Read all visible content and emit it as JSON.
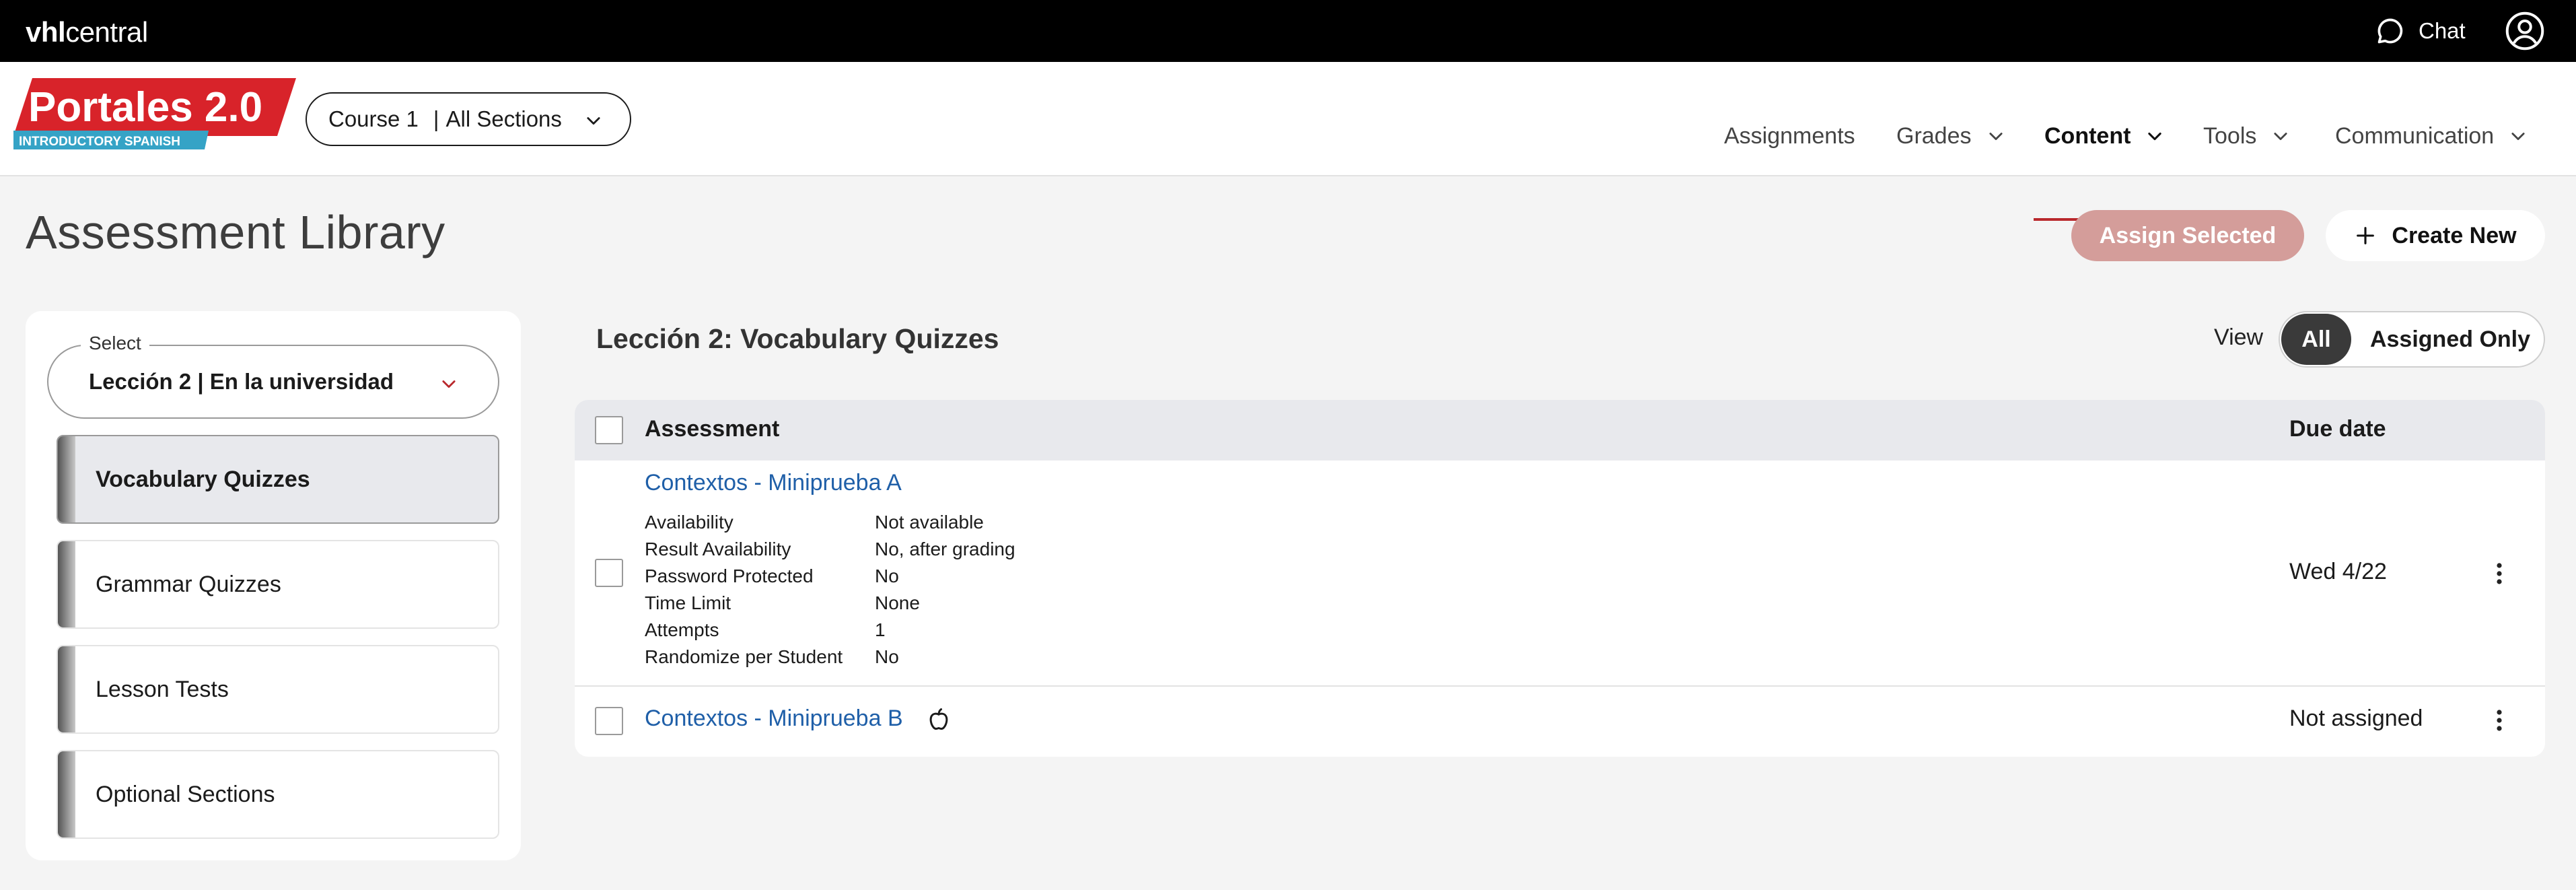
{
  "topbar": {
    "brand_bold": "vhl",
    "brand_light": "central",
    "chat_label": "Chat",
    "icons": [
      "chat-bubble-icon",
      "user-circle-icon"
    ]
  },
  "header": {
    "logo_main": "Portales 2.0",
    "logo_sub": "INTRODUCTORY SPANISH",
    "course": "Course 1",
    "section": "All Sections",
    "nav": [
      {
        "label": "Assignments",
        "active": false,
        "dropdown": false
      },
      {
        "label": "Grades",
        "active": false,
        "dropdown": true
      },
      {
        "label": "Content",
        "active": true,
        "dropdown": true
      },
      {
        "label": "Tools",
        "active": false,
        "dropdown": true
      },
      {
        "label": "Communication",
        "active": false,
        "dropdown": true
      }
    ]
  },
  "page": {
    "title": "Assessment Library",
    "assign_selected_label": "Assign Selected",
    "create_new_label": "Create New"
  },
  "sidebar": {
    "select_legend": "Select",
    "select_value": "Lección 2 | En la universidad",
    "items": [
      {
        "label": "Vocabulary Quizzes",
        "active": true
      },
      {
        "label": "Grammar Quizzes",
        "active": false
      },
      {
        "label": "Lesson Tests",
        "active": false
      },
      {
        "label": "Optional Sections",
        "active": false
      }
    ]
  },
  "main": {
    "section_title": "Lección 2: Vocabulary Quizzes",
    "view_label": "View",
    "view_options": [
      "All",
      "Assigned Only"
    ],
    "view_selected": "All",
    "columns": {
      "assessment": "Assessment",
      "due_date": "Due date"
    },
    "rows": [
      {
        "title": "Contextos - Miniprueba A",
        "due": "Wed 4/22",
        "details": [
          {
            "label": "Availability",
            "value": "Not available"
          },
          {
            "label": "Result Availability",
            "value": "No, after grading"
          },
          {
            "label": "Password Protected",
            "value": "No"
          },
          {
            "label": "Time Limit",
            "value": "None"
          },
          {
            "label": "Attempts",
            "value": "1"
          },
          {
            "label": "Randomize per Student",
            "value": "No"
          }
        ]
      },
      {
        "title": "Contextos - Miniprueba B",
        "due": "Not assigned",
        "icon": "apple-icon"
      }
    ]
  },
  "colors": {
    "topbar": "#000000",
    "accent_red": "#b9282c",
    "assign_button": "#d49d9a",
    "link": "#1f5fa8",
    "toggle_active": "#3a3a3a",
    "page_bg": "#f4f4f4"
  }
}
